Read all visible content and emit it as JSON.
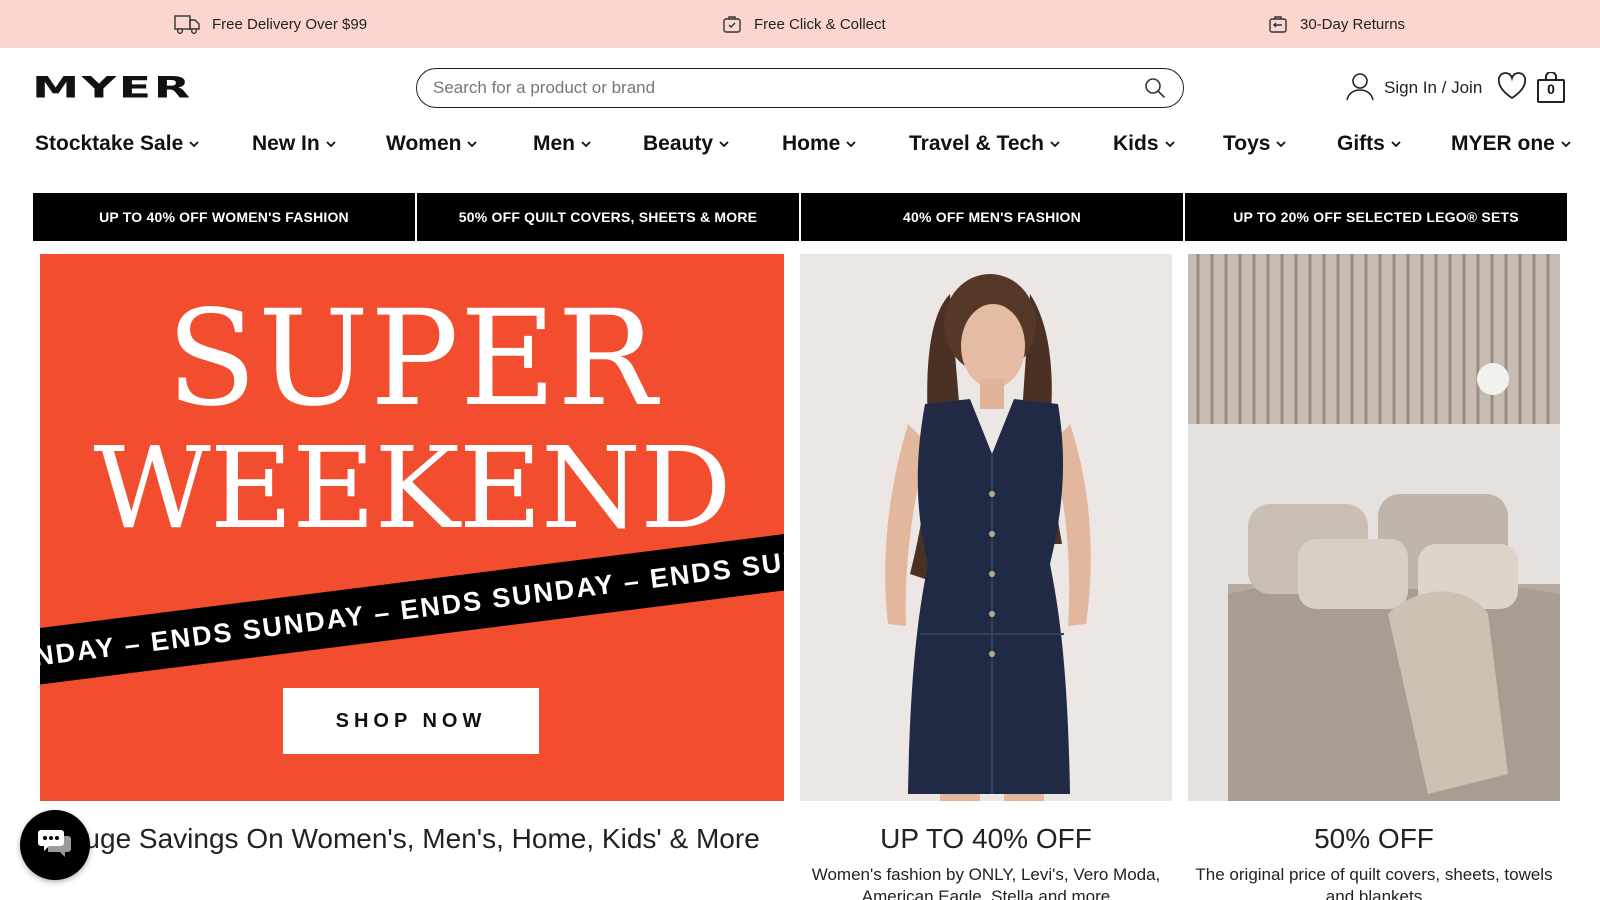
{
  "promo_bar": {
    "items": [
      {
        "icon": "truck-icon",
        "label": "Free Delivery Over $99"
      },
      {
        "icon": "click-collect-icon",
        "label": "Free Click & Collect"
      },
      {
        "icon": "returns-icon",
        "label": "30-Day Returns"
      }
    ],
    "background": "#fbd6cf"
  },
  "header": {
    "logo": "MYER",
    "search_placeholder": "Search for a product or brand",
    "account_label": "Sign In / Join",
    "bag_count": "0"
  },
  "nav": {
    "items": [
      "Stocktake Sale",
      "New In",
      "Women",
      "Men",
      "Beauty",
      "Home",
      "Travel & Tech",
      "Kids",
      "Toys",
      "Gifts",
      "MYER one"
    ]
  },
  "category_strip": {
    "items": [
      "UP TO 40% OFF WOMEN'S FASHION",
      "50% OFF QUILT COVERS, SHEETS & MORE",
      "40% OFF MEN'S FASHION",
      "UP TO 20% OFF SELECTED LEGO® SETS"
    ]
  },
  "hero": {
    "title_line1": "SUPER",
    "title_line2": "WEEKEND",
    "ribbon": "NDAY – ENDS SUNDAY – ENDS SUNDAY – ENDS SUND",
    "cta": "SHOP NOW",
    "background": "#f24d2e",
    "caption": "Huge Savings On Women's, Men's, Home, Kids' & More"
  },
  "tiles": [
    {
      "title": "UP TO 40% OFF",
      "subtitle": "Women's fashion by ONLY, Levi's, Vero Moda, American Eagle, Stella and more"
    },
    {
      "title": "50% OFF",
      "subtitle": "The original price of quilt covers, sheets, towels and blankets"
    }
  ]
}
